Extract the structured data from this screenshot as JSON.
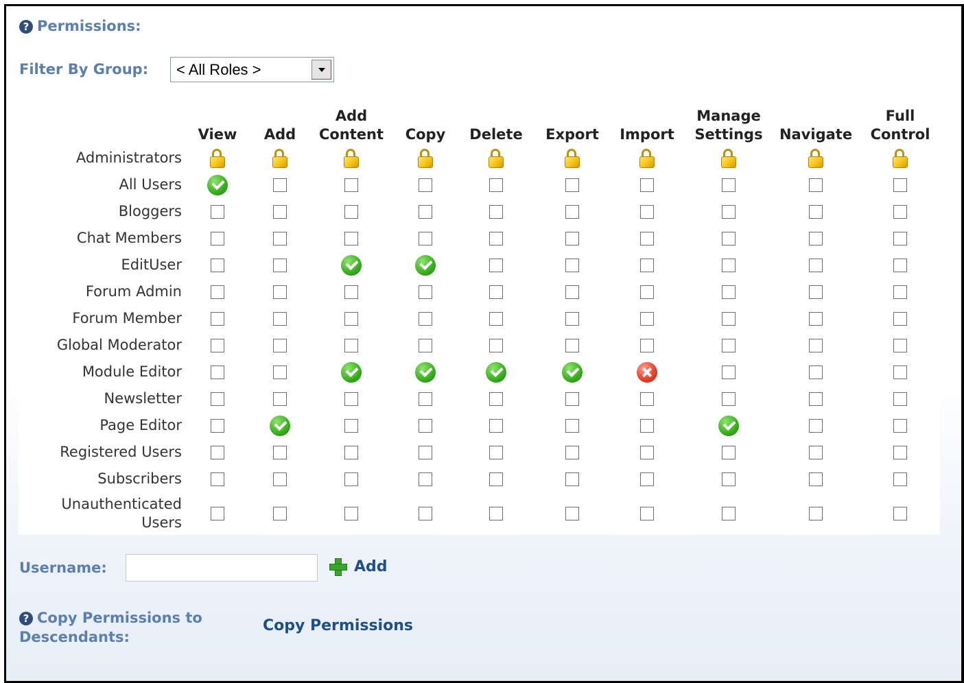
{
  "header": {
    "title": "Permissions:",
    "help_icon": "help-icon"
  },
  "filter": {
    "label": "Filter By Group:",
    "selected": "< All Roles >"
  },
  "columns": [
    {
      "line1": "",
      "line2": "View"
    },
    {
      "line1": "",
      "line2": "Add"
    },
    {
      "line1": "Add",
      "line2": "Content"
    },
    {
      "line1": "",
      "line2": "Copy"
    },
    {
      "line1": "",
      "line2": "Delete"
    },
    {
      "line1": "",
      "line2": "Export"
    },
    {
      "line1": "",
      "line2": "Import"
    },
    {
      "line1": "Manage",
      "line2": "Settings"
    },
    {
      "line1": "",
      "line2": "Navigate"
    },
    {
      "line1": "Full",
      "line2": "Control"
    }
  ],
  "rows": [
    {
      "line1": "",
      "line2": "Administrators",
      "states": [
        "locked",
        "locked",
        "locked",
        "locked",
        "locked",
        "locked",
        "locked",
        "locked",
        "locked",
        "locked"
      ]
    },
    {
      "line1": "",
      "line2": "All Users",
      "states": [
        "grant",
        "none",
        "none",
        "none",
        "none",
        "none",
        "none",
        "none",
        "none",
        "none"
      ]
    },
    {
      "line1": "",
      "line2": "Bloggers",
      "states": [
        "none",
        "none",
        "none",
        "none",
        "none",
        "none",
        "none",
        "none",
        "none",
        "none"
      ]
    },
    {
      "line1": "",
      "line2": "Chat Members",
      "states": [
        "none",
        "none",
        "none",
        "none",
        "none",
        "none",
        "none",
        "none",
        "none",
        "none"
      ]
    },
    {
      "line1": "",
      "line2": "EditUser",
      "states": [
        "none",
        "none",
        "grant",
        "grant",
        "none",
        "none",
        "none",
        "none",
        "none",
        "none"
      ]
    },
    {
      "line1": "",
      "line2": "Forum Admin",
      "states": [
        "none",
        "none",
        "none",
        "none",
        "none",
        "none",
        "none",
        "none",
        "none",
        "none"
      ]
    },
    {
      "line1": "",
      "line2": "Forum Member",
      "states": [
        "none",
        "none",
        "none",
        "none",
        "none",
        "none",
        "none",
        "none",
        "none",
        "none"
      ]
    },
    {
      "line1": "",
      "line2": "Global Moderator",
      "states": [
        "none",
        "none",
        "none",
        "none",
        "none",
        "none",
        "none",
        "none",
        "none",
        "none"
      ]
    },
    {
      "line1": "",
      "line2": "Module Editor",
      "states": [
        "none",
        "none",
        "grant",
        "grant",
        "grant",
        "grant",
        "deny",
        "none",
        "none",
        "none"
      ]
    },
    {
      "line1": "",
      "line2": "Newsletter",
      "states": [
        "none",
        "none",
        "none",
        "none",
        "none",
        "none",
        "none",
        "none",
        "none",
        "none"
      ]
    },
    {
      "line1": "",
      "line2": "Page Editor",
      "states": [
        "none",
        "grant",
        "none",
        "none",
        "none",
        "none",
        "none",
        "grant",
        "none",
        "none"
      ]
    },
    {
      "line1": "",
      "line2": "Registered Users",
      "states": [
        "none",
        "none",
        "none",
        "none",
        "none",
        "none",
        "none",
        "none",
        "none",
        "none"
      ]
    },
    {
      "line1": "",
      "line2": "Subscribers",
      "states": [
        "none",
        "none",
        "none",
        "none",
        "none",
        "none",
        "none",
        "none",
        "none",
        "none"
      ]
    },
    {
      "line1": "Unauthenticated",
      "line2": "Users",
      "states": [
        "none",
        "none",
        "none",
        "none",
        "none",
        "none",
        "none",
        "none",
        "none",
        "none"
      ]
    }
  ],
  "username": {
    "label": "Username:",
    "value": "",
    "add_label": "Add",
    "add_icon": "plus-icon"
  },
  "copy": {
    "label": "Copy Permissions to Descendants:",
    "button": "Copy Permissions",
    "help_icon": "help-icon"
  },
  "colors": {
    "accent_label": "#5b7fae",
    "link": "#1f4f8a",
    "grant": "#3cb31f",
    "deny": "#e8452f",
    "lock": "#f6c316"
  }
}
